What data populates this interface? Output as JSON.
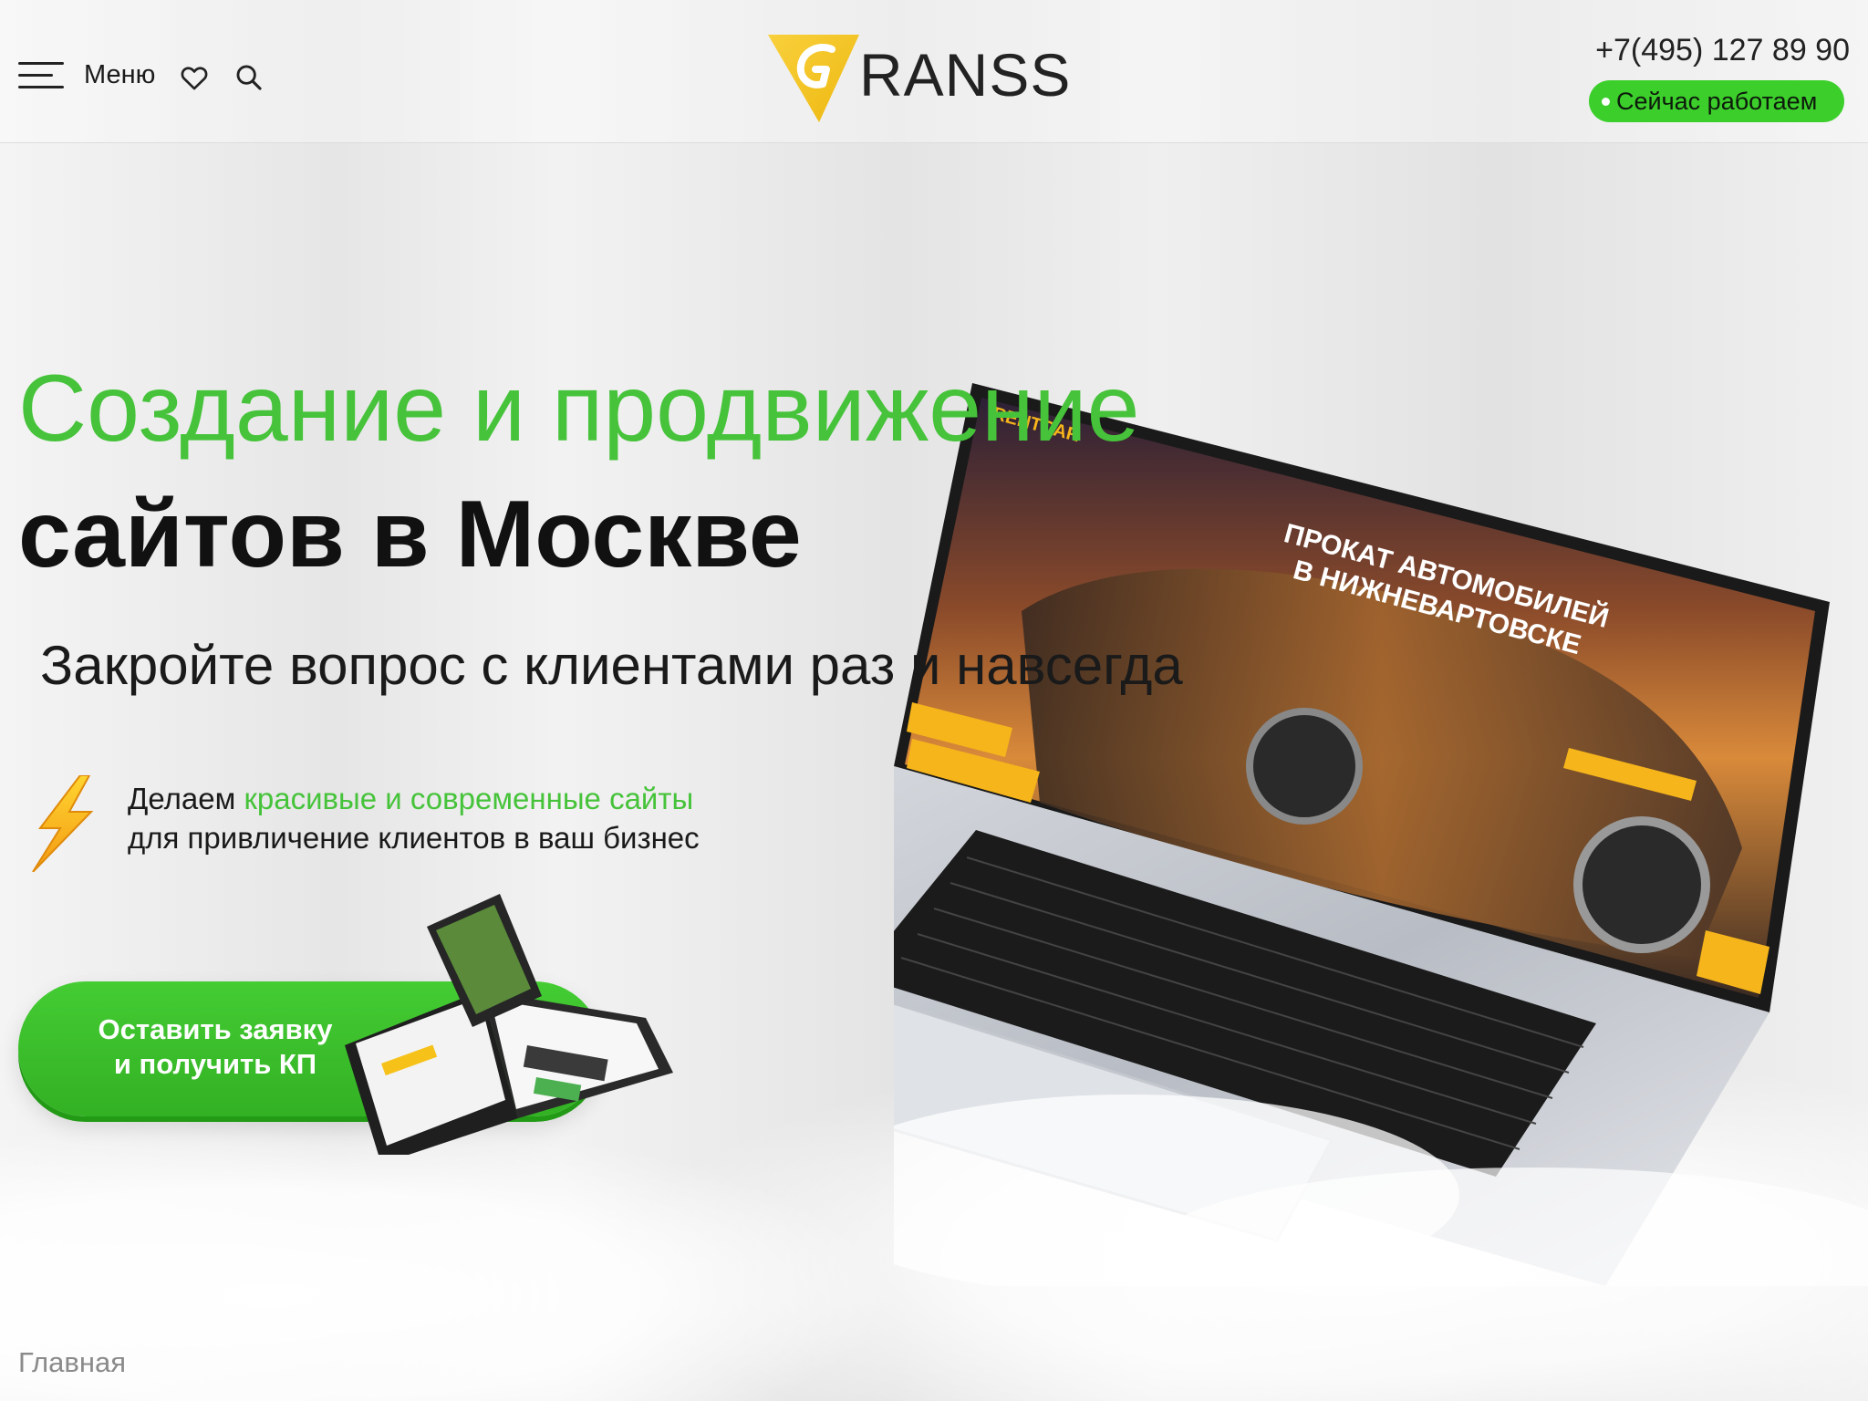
{
  "header": {
    "menu_label": "Меню",
    "logo_text": "RANSS",
    "phone": "+7(495) 127 89 90",
    "status": "Сейчас работаем"
  },
  "icons": {
    "menu": "hamburger-icon",
    "favorites": "heart-icon",
    "search": "search-icon",
    "logo": "logo-triangle-icon",
    "feature": "lightning-icon"
  },
  "hero": {
    "title_line1": "Создание и продвижение",
    "title_line2": "сайтов в Москве",
    "subtitle": "Закройте вопрос с клиентами раз и навсегда",
    "feature_prefix": "Делаем ",
    "feature_highlight": "красивые и современные сайты",
    "feature_line2": "для привличение клиентов в ваш бизнес"
  },
  "cta": {
    "line1": "Оставить заявку",
    "line2": "и получить КП"
  },
  "laptop_screen": {
    "brand": "RENTCAR",
    "headline_1": "ПРОКАТ АВТОМОБИЛЕЙ",
    "headline_2": "В НИЖНЕВАРТОВСКЕ"
  },
  "breadcrumb": "Главная",
  "colors": {
    "accent_green": "#46c33a",
    "button_green": "#3ccf2b",
    "logo_yellow": "#f5c518",
    "text_dark": "#111111"
  }
}
